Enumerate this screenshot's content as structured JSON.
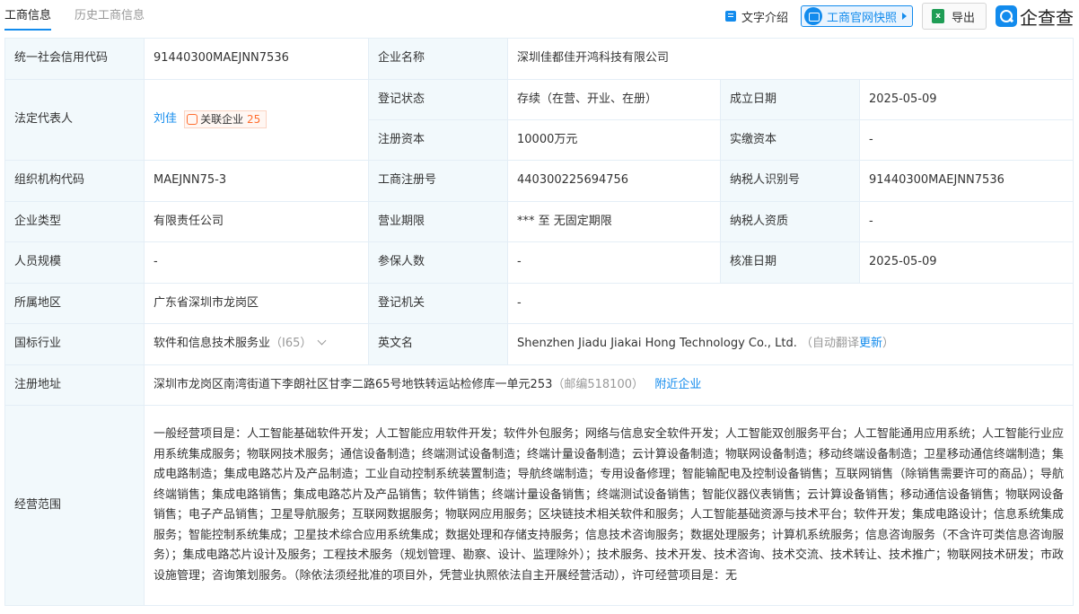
{
  "tabs": {
    "active": "工商信息",
    "inactive": "历史工商信息"
  },
  "toolbar": {
    "intro_label": "文字介绍",
    "snapshot_label": "工商官网快照",
    "export_label": "导出",
    "xls_glyph": "x",
    "logo_text": "企查查"
  },
  "rows": {
    "credit_code_label": "统一社会信用代码",
    "credit_code": "91440300MAEJNN7536",
    "company_name_label": "企业名称",
    "company_name": "深圳佳都佳开鸿科技有限公司",
    "legal_rep_label": "法定代表人",
    "legal_rep": "刘佳",
    "assoc_label": "关联企业",
    "assoc_count": "25",
    "reg_status_label": "登记状态",
    "reg_status": "存续（在营、开业、在册）",
    "found_date_label": "成立日期",
    "found_date": "2025-05-09",
    "reg_capital_label": "注册资本",
    "reg_capital": "10000万元",
    "paid_capital_label": "实缴资本",
    "paid_capital": "-",
    "org_code_label": "组织机构代码",
    "org_code": "MAEJNN75-3",
    "biz_reg_no_label": "工商注册号",
    "biz_reg_no": "440300225694756",
    "taxpayer_id_label": "纳税人识别号",
    "taxpayer_id": "91440300MAEJNN7536",
    "company_type_label": "企业类型",
    "company_type": "有限责任公司",
    "biz_term_label": "营业期限",
    "biz_term": "*** 至 无固定期限",
    "taxpayer_qual_label": "纳税人资质",
    "taxpayer_qual": "-",
    "staff_size_label": "人员规模",
    "staff_size": "-",
    "insured_label": "参保人数",
    "insured": "-",
    "approval_date_label": "核准日期",
    "approval_date": "2025-05-09",
    "region_label": "所属地区",
    "region": "广东省深圳市龙岗区",
    "reg_authority_label": "登记机关",
    "reg_authority": "-",
    "industry_label": "国标行业",
    "industry": "软件和信息技术服务业",
    "industry_code": "（I65）",
    "english_name_label": "英文名",
    "english_name": "Shenzhen Jiadu Jiakai Hong Technology Co., Ltd.",
    "auto_translate": "（自动翻译",
    "update_link": "更新",
    "auto_translate_close": "）",
    "address_label": "注册地址",
    "address": "深圳市龙岗区南湾街道下李朗社区甘李二路65号地铁转运站检修库一单元253",
    "postcode": "（邮编518100）",
    "nearby_link": "附近企业",
    "scope_label": "经营范围",
    "scope": "一般经营项目是：人工智能基础软件开发；人工智能应用软件开发；软件外包服务；网络与信息安全软件开发；人工智能双创服务平台；人工智能通用应用系统；人工智能行业应用系统集成服务；物联网技术服务；通信设备制造；终端测试设备制造；终端计量设备制造；云计算设备制造；物联网设备制造；移动终端设备制造；卫星移动通信终端制造；集成电路制造；集成电路芯片及产品制造；工业自动控制系统装置制造；导航终端制造；专用设备修理；智能输配电及控制设备销售；互联网销售（除销售需要许可的商品）；导航终端销售；集成电路销售；集成电路芯片及产品销售；软件销售；终端计量设备销售；终端测试设备销售；智能仪器仪表销售；云计算设备销售；移动通信设备销售；物联网设备销售；电子产品销售；卫星导航服务；互联网数据服务；物联网应用服务；区块链技术相关软件和服务；人工智能基础资源与技术平台；软件开发；集成电路设计；信息系统集成服务；智能控制系统集成；卫星技术综合应用系统集成；数据处理和存储支持服务；信息技术咨询服务；数据处理服务；计算机系统服务；信息咨询服务（不含许可类信息咨询服务）；集成电路芯片设计及服务；工程技术服务（规划管理、勘察、设计、监理除外）；技术服务、技术开发、技术咨询、技术交流、技术转让、技术推广；物联网技术研发；市政设施管理；咨询策划服务。（除依法须经批准的项目外，凭营业执照依法自主开展经营活动），许可经营项目是：无"
  }
}
